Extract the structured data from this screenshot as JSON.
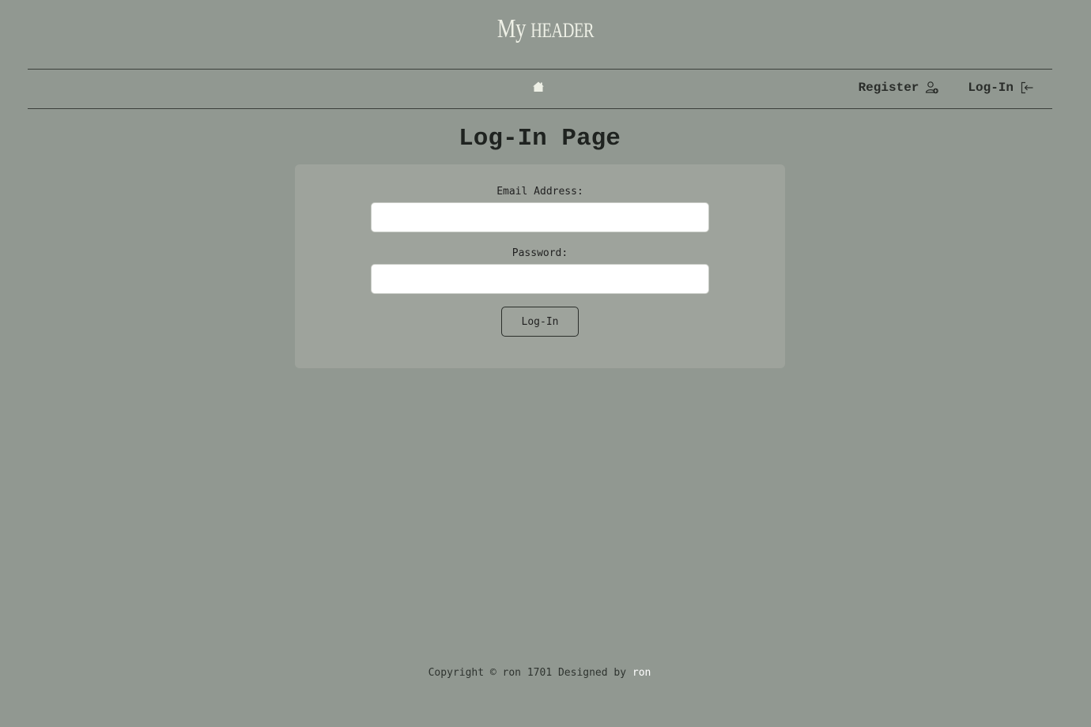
{
  "header": {
    "title_first": "My",
    "title_rest": "header"
  },
  "nav": {
    "home_icon": "home-icon",
    "register_label": "Register",
    "register_icon": "user-add-icon",
    "login_label": "Log-In",
    "login_icon": "sign-in-icon"
  },
  "page": {
    "heading": "Log-In Page"
  },
  "form": {
    "email_label": "Email Address:",
    "email_value": "",
    "password_label": "Password:",
    "password_value": "",
    "submit_label": "Log-In"
  },
  "footer": {
    "copyright_text": "Copyright © ron 1701 Designed by",
    "author_link": "ron"
  },
  "colors": {
    "page_background": "#919891",
    "card_background": "#9ea39c",
    "header_title": "#eef0e6",
    "link_accent": "#ffffff"
  }
}
